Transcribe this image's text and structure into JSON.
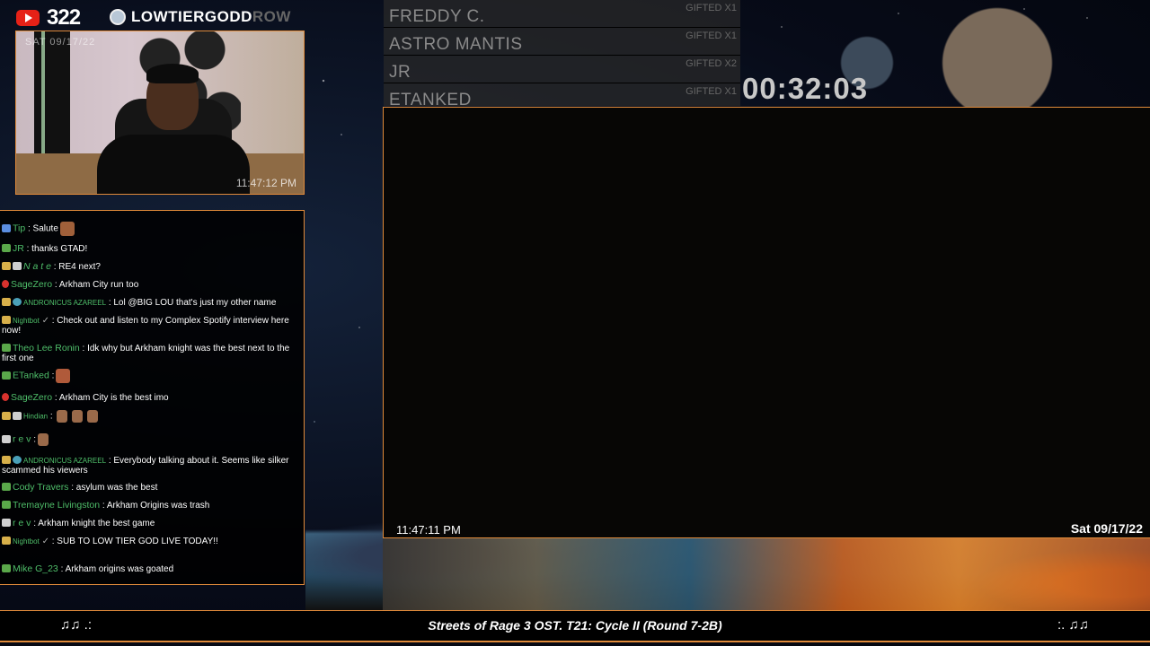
{
  "header": {
    "youtube_count": "322",
    "channel_name": "LOWTIERGODD",
    "channel_suffix": "ROW"
  },
  "webcam": {
    "date_overlay": "SAT 09/17/22",
    "time_overlay": "11:47:12 PM"
  },
  "chat": {
    "messages": [
      {
        "user": "Tip",
        "text": ": Salute",
        "color": "#4fbf6a"
      },
      {
        "user": "JR",
        "text": ": thanks GTAD!",
        "color": "#4fbf6a"
      },
      {
        "user": "N a t e",
        "text": ": RE4 next?",
        "color": "#4fbf6a"
      },
      {
        "user": "SageZero",
        "text": ": Arkham City run too",
        "color": "#4fbf6a"
      },
      {
        "user": "ANDRONICUS AZAREEL",
        "text": ": Lol @BIG LOU that's just my other name",
        "color": "#4fbf6a"
      },
      {
        "user": "Nightbot",
        "check": "✓",
        "text": ": Check out and listen to my Complex Spotify interview here now!",
        "color": "#4fbf6a"
      },
      {
        "user": "Theo Lee Ronin",
        "text": ": Idk why but Arkham knight was the best next to the first one",
        "color": "#4fbf6a"
      },
      {
        "user": "ETanked",
        "text": ":",
        "color": "#4fbf6a"
      },
      {
        "user": "SageZero",
        "text": ": Arkham City is the best imo",
        "color": "#4fbf6a"
      },
      {
        "user": "Hindian",
        "text": ":",
        "color": "#4fbf6a"
      },
      {
        "user": "r e v",
        "text": ":",
        "color": "#4fbf6a"
      },
      {
        "user": "ANDRONICUS AZAREEL",
        "text": ": Everybody talking about it. Seems like silker scammed his viewers",
        "color": "#4fbf6a"
      },
      {
        "user": "Cody Travers",
        "text": ": asylum was the best",
        "color": "#4fbf6a"
      },
      {
        "user": "Tremayne Livingston",
        "text": ": Arkham Origins was trash",
        "color": "#4fbf6a"
      },
      {
        "user": "r e v",
        "text": ": Arkham knight the best game",
        "color": "#4fbf6a"
      },
      {
        "user": "Nightbot",
        "check": "✓",
        "text": ": SUB TO LOW TIER GOD LIVE TODAY!!",
        "color": "#4fbf6a"
      },
      {
        "user": "Mike G_23",
        "text": ": Arkham origins was goated",
        "color": "#4fbf6a"
      }
    ]
  },
  "gifted": [
    {
      "name": "FREDDY C.",
      "tag": "GIFTED X1"
    },
    {
      "name": "ASTRO MANTIS",
      "tag": "GIFTED X1"
    },
    {
      "name": "JR",
      "tag": "GIFTED X2"
    },
    {
      "name": "ETANKED",
      "tag": "GIFTED X1"
    }
  ],
  "timer": "00:32:03",
  "game": {
    "time": "11:47:11 PM",
    "date": "Sat 09/17/22"
  },
  "bottom_bar": {
    "notes_left": "♫♫ .:",
    "song": "Streets of Rage 3 OST. T21: Cycle II (Round 7-2B)",
    "notes_right": ":. ♫♫"
  },
  "colors": {
    "accent": "#e08a3a",
    "chat_name": "#4fbf6a"
  }
}
